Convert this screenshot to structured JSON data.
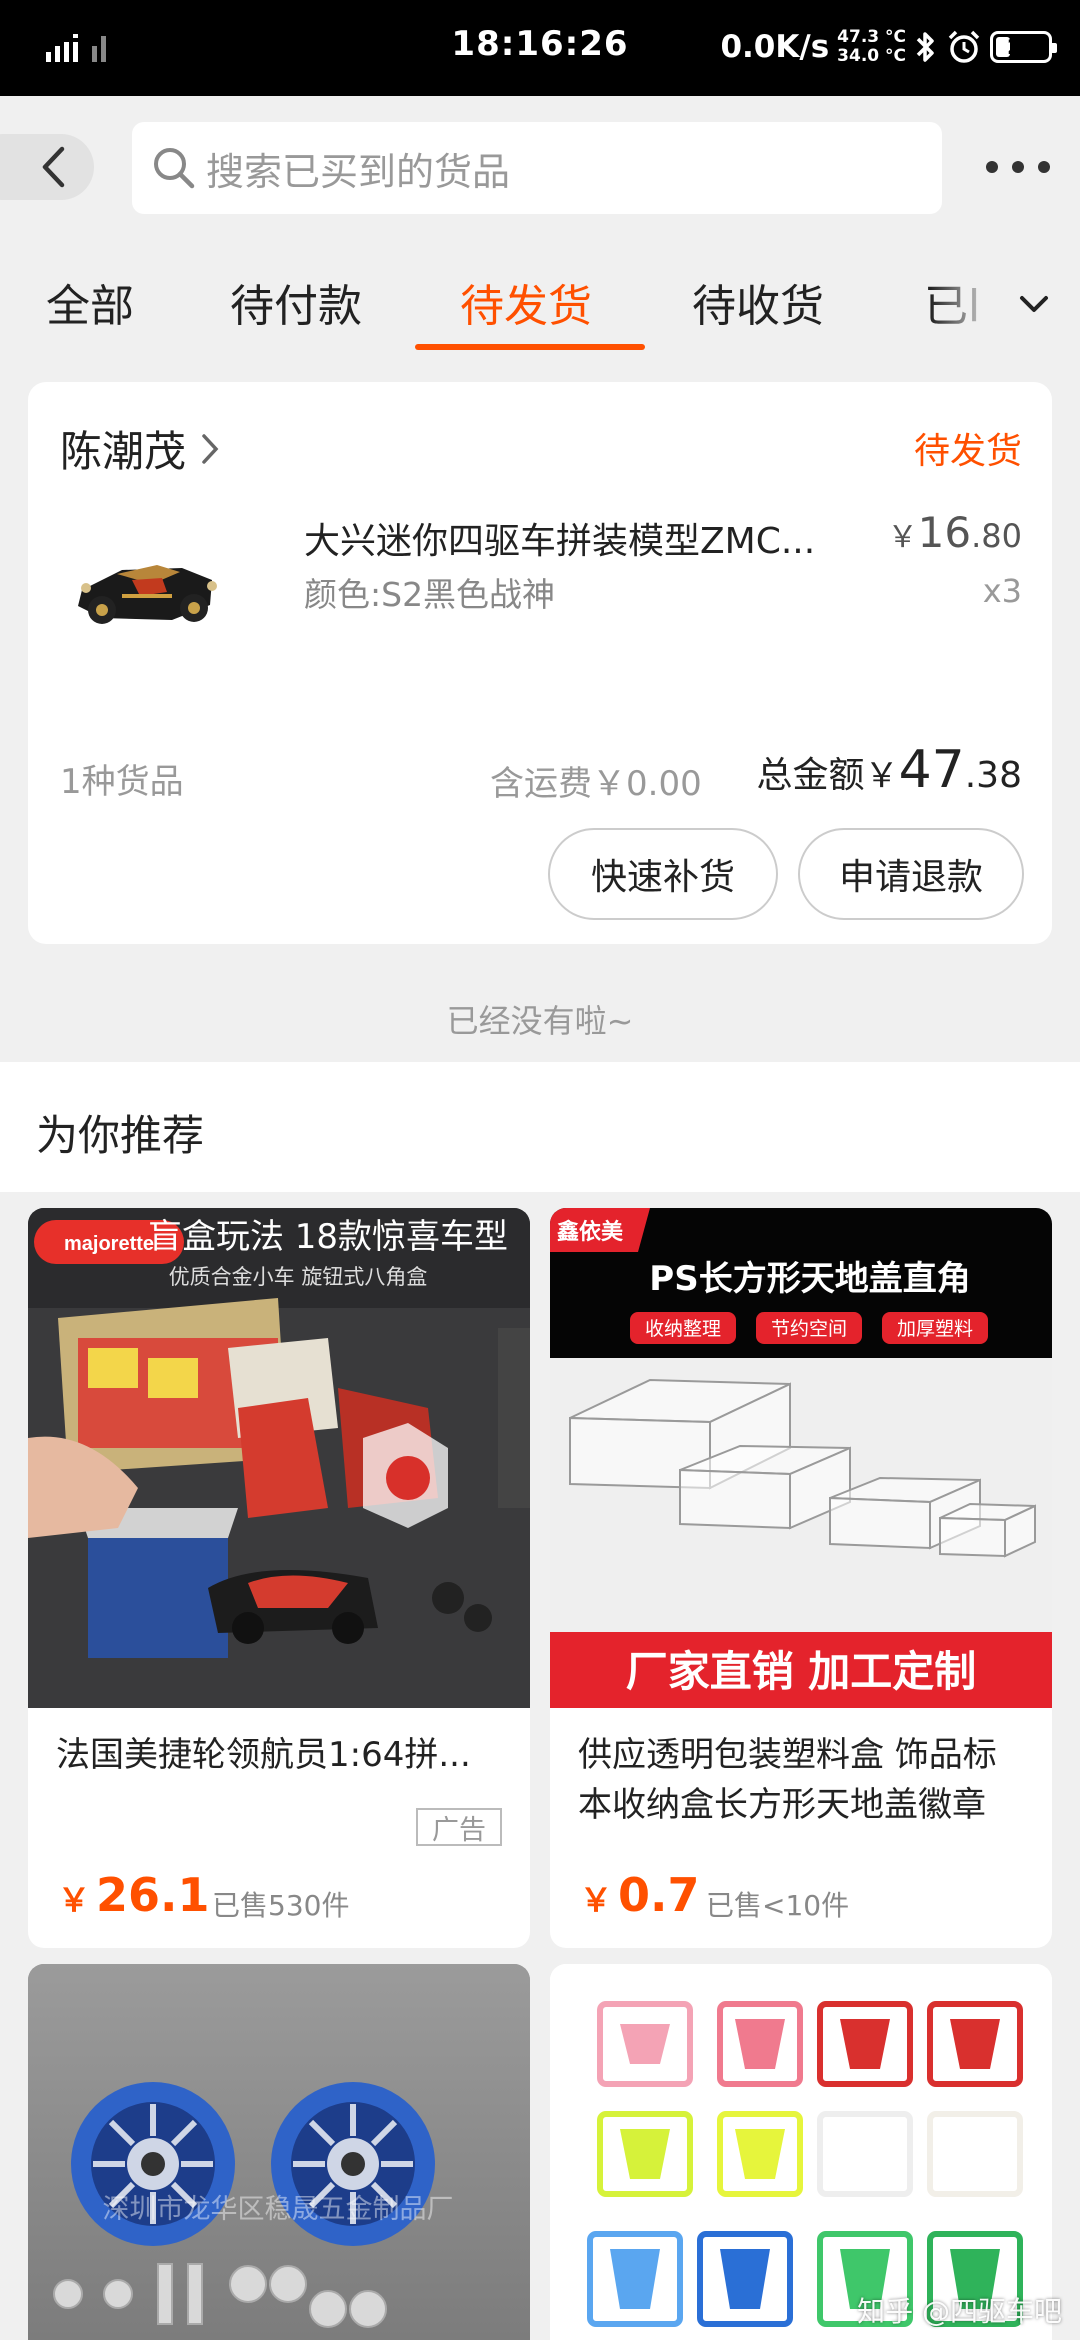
{
  "status_bar": {
    "time": "18:16:26",
    "net_speed": "0.0K/s",
    "temp_high": "47.3 °C",
    "temp_low": "34.0 °C",
    "battery": "24"
  },
  "header": {
    "search_placeholder": "搜索已买到的货品"
  },
  "tabs": [
    {
      "label": "全部"
    },
    {
      "label": "待付款"
    },
    {
      "label": "待发货"
    },
    {
      "label": "待收货"
    },
    {
      "label": "已l"
    }
  ],
  "active_tab": "待发货",
  "order": {
    "shop_name": "陈潮茂",
    "status": "待发货",
    "product": {
      "title": "大兴迷你四驱车拼装模型ZMC...",
      "spec": "颜色:S2黑色战神",
      "price_currency": "￥",
      "price_int": "16",
      "price_dec": ".80",
      "qty": "x3"
    },
    "goods_count": "1种货品",
    "shipping": "含运费￥0.00",
    "total_label": "总金额",
    "total_currency": "￥",
    "total_int": "47",
    "total_dec": ".38",
    "buttons": {
      "refill": "快速补货",
      "refund": "申请退款"
    }
  },
  "no_more_text": "已经没有啦~",
  "recommend": {
    "title": "为你推荐",
    "items": [
      {
        "title": "法国美捷轮领航员1:64拼...",
        "ad": "广告",
        "currency": "￥",
        "price": "26.1",
        "sold": "已售530件",
        "image": {
          "brand": "majorette",
          "headline": "盲盒玩法 18款惊喜车型",
          "subline": "优质合金小车 旋钮式八角盒"
        }
      },
      {
        "title": "供应透明包装塑料盒 饰品标本收纳盒长方形天地盖徽章",
        "currency": "￥",
        "price": "0.7",
        "sold": "已售<10件",
        "image": {
          "brand": "鑫依美",
          "headline": "PS长方形天地盖直角",
          "tags": [
            "收纳整理",
            "节约空间",
            "加厚塑料"
          ],
          "banner": "厂家直销 加工定制"
        }
      },
      {
        "image": {
          "watermark": "深圳市龙华区稳晟五金制品厂"
        }
      },
      {
        "image": {}
      }
    ]
  },
  "watermark": "知乎 @四驱车吧"
}
